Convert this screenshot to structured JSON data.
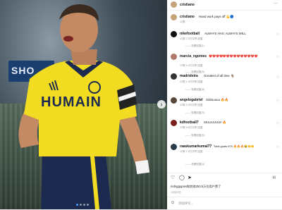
{
  "post": {
    "author": "cristiano",
    "caption_user": "cristiano",
    "caption": "Hand work pays off 💪🔵",
    "caption_age": "12周",
    "jersey_text": "HUMAIN",
    "board_text": "SHO",
    "likes_text": "mdrygpgoes和其他253.5万位用户赞了",
    "date": "12月20日",
    "add_comment": "添加评论..."
  },
  "comments": [
    {
      "user": "nikefootball",
      "text": "ALWAYS HAS. ALWAYS WILL",
      "meta": "12周  3.5万次赞  回复",
      "replies": "—— 查看回复(1)"
    },
    {
      "user": "marcia_ngomes",
      "text": "❤️❤️❤️❤️❤️❤️❤️❤️❤️❤️❤️❤️❤️❤️",
      "meta": "12周  4.4万次赞  回复",
      "replies": "—— 查看回复(9)"
    },
    {
      "user": "madridxtra",
      "text": "Greatest of all time 🐐",
      "meta": "12周  1.9万次赞  回复",
      "replies": "—— 查看回复(8)"
    },
    {
      "user": "angelogabriel",
      "text": "Siiiiiuuuuu 🔥🔥",
      "meta": "12周  3.9万次赞  回复",
      "replies": "—— 查看回复(9)"
    },
    {
      "user": "kdfootball7",
      "text": "SIUUUUUU!! 🔥",
      "meta": "12周  4.6万次赞  回复",
      "replies": "—— 查看回复(6)"
    },
    {
      "user": "raaskumarkumal77",
      "text": "Total goals 979 🔥🔥🔥😂👏👏",
      "meta": "12周  2.9万次赞  回复",
      "replies": "—— 查看回复(4)"
    }
  ],
  "colors": {
    "jersey": "#f2dc21",
    "shorts": "#1c2a4f",
    "skin": "#c48a63"
  }
}
